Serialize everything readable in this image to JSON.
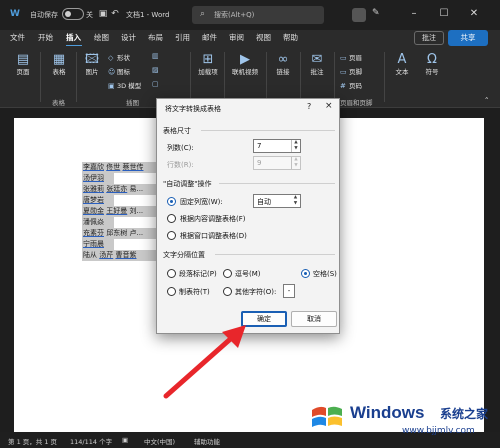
{
  "titlebar": {
    "autosave_label": "自动保存",
    "autosave_state": "关",
    "doc_title": "文档1 - Word",
    "search_placeholder": "搜索(Alt+Q)",
    "icons": [
      "word-logo-icon",
      "save-icon",
      "undo-icon",
      "redo-icon",
      "search-icon",
      "pen-icon",
      "minimize-icon",
      "maximize-icon",
      "close-icon"
    ]
  },
  "menu": {
    "tabs": [
      "文件",
      "开始",
      "插入",
      "绘图",
      "设计",
      "布局",
      "引用",
      "邮件",
      "审阅",
      "视图",
      "帮助"
    ],
    "active_tab": "插入",
    "comment_label": "批注",
    "share_label": "共享"
  },
  "ribbon": {
    "pages": "页面",
    "table": "表格",
    "picture": "图片",
    "shapes": "形状",
    "icons": "图标",
    "model3d": "3D 模型",
    "addins": "加载项",
    "online_video": "联机视频",
    "link": "链接",
    "comment": "批注",
    "header": "页眉",
    "footer": "页脚",
    "page_number": "页码",
    "text": "文本",
    "symbol": "符号",
    "groups": {
      "table": "表格",
      "illustrations": "插图",
      "header_footer": "页眉和页脚"
    }
  },
  "document": {
    "lines": [
      [
        "李嘉欣",
        "佟世",
        "蔡世传"
      ],
      [
        "汤伊羽"
      ],
      [
        "张雅莉",
        "张廷亦",
        "易..."
      ],
      [
        "唐梦岩"
      ],
      [
        "夏勋金",
        "王好曼",
        "刘..."
      ],
      [
        "潘佩焱"
      ],
      [
        "充素芬",
        "邱东树",
        "卢..."
      ],
      [
        "宁雨晨"
      ],
      [
        "陆从",
        "汤芹",
        "曹音紫"
      ]
    ]
  },
  "dialog": {
    "title": "将文字转换成表格",
    "help": "?",
    "close": "×",
    "table_size_label": "表格尺寸",
    "columns_label": "列数(C):",
    "columns_value": "7",
    "rows_label": "行数(R):",
    "rows_value": "9",
    "autofit_label": "\"自动调整\"操作",
    "fixed_width_label": "固定列宽(W):",
    "fixed_width_value": "自动",
    "autofit_content_label": "根据内容调整表格(F)",
    "autofit_window_label": "根据窗口调整表格(D)",
    "separator_label": "文字分隔位置",
    "sep_paragraph": "段落标记(P)",
    "sep_comma": "逗号(M)",
    "sep_space": "空格(S)",
    "sep_tab": "制表符(T)",
    "sep_other": "其他字符(O):",
    "sep_other_value": "-",
    "ok_label": "确定",
    "cancel_label": "取消",
    "selected_autofit": "fixed",
    "selected_separator": "space"
  },
  "statusbar": {
    "page": "第 1 页，共 1 页",
    "words": "114/114 个字",
    "lang": "中文(中国)",
    "accessibility": "辅助功能"
  },
  "watermark": {
    "brand": "Windows",
    "cn": "系统之家",
    "url": "www.bjjmlv.com"
  },
  "colors": {
    "accent": "#1a5fb4",
    "share": "#1d6fc1",
    "arrow": "#e8262b",
    "watermark": "#1a3f8f"
  }
}
